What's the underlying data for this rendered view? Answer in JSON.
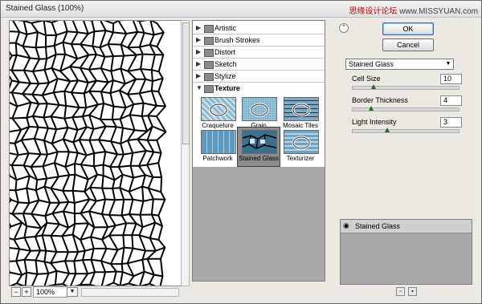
{
  "window": {
    "title": "Stained Glass (100%)",
    "watermark_cn": "思缘设计论坛",
    "watermark_site": "www.MISSYUAN.com"
  },
  "preview": {
    "zoom_value": "100%",
    "zoom_out_icon": "minus-icon",
    "zoom_in_icon": "plus-icon"
  },
  "gallery": {
    "categories": [
      {
        "label": "Artistic"
      },
      {
        "label": "Brush Strokes"
      },
      {
        "label": "Distort"
      },
      {
        "label": "Sketch"
      },
      {
        "label": "Stylize"
      },
      {
        "label": "Texture"
      }
    ],
    "texture_filters": [
      {
        "label": "Craquelure"
      },
      {
        "label": "Grain"
      },
      {
        "label": "Mosaic Tiles"
      },
      {
        "label": "Patchwork"
      },
      {
        "label": "Stained Glass"
      },
      {
        "label": "Texturizer"
      }
    ],
    "selected_filter": "Stained Glass"
  },
  "buttons": {
    "ok": "OK",
    "cancel": "Cancel"
  },
  "settings": {
    "filter_select": "Stained Glass",
    "params": [
      {
        "label": "Cell Size",
        "value": "10",
        "fraction": 0.18
      },
      {
        "label": "Border Thickness",
        "value": "4",
        "fraction": 0.16
      },
      {
        "label": "Light Intensity",
        "value": "3",
        "fraction": 0.31
      }
    ]
  },
  "layers": {
    "items": [
      {
        "label": "Stained Glass"
      }
    ]
  },
  "colors": {
    "dialog_bg": "#ece9e3",
    "gallery_bg": "#a9a9a9",
    "selected_thumb": "#8c8c8c",
    "slider_knob": "#2e5e2e"
  }
}
